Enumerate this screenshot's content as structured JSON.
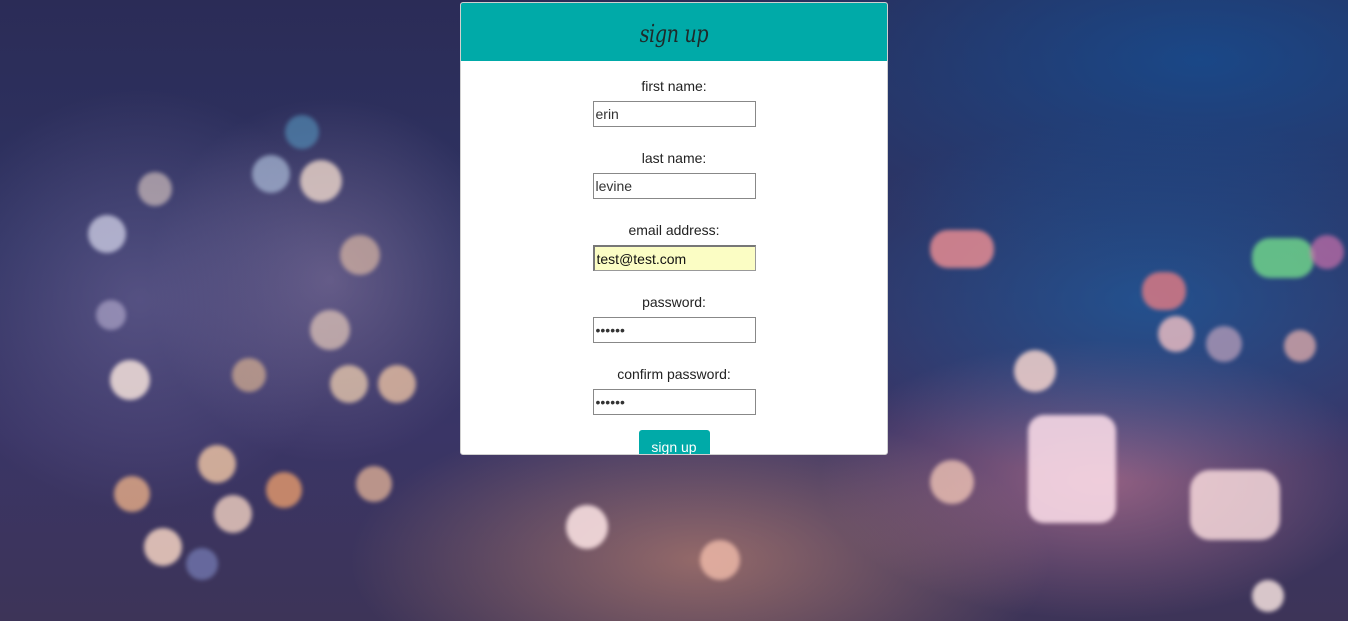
{
  "form": {
    "title": "sign up",
    "fields": [
      {
        "label": "first name:",
        "value": "erin",
        "type": "text"
      },
      {
        "label": "last name:",
        "value": "levine",
        "type": "text"
      },
      {
        "label": "email address:",
        "value": "test@test.com",
        "type": "text"
      },
      {
        "label": "password:",
        "value": "••••••",
        "type": "password"
      },
      {
        "label": "confirm password:",
        "value": "••••••",
        "type": "password"
      }
    ],
    "submit_label": "sign up"
  },
  "colors": {
    "accent": "#00aaa8",
    "autofill": "#fbfdc4"
  }
}
